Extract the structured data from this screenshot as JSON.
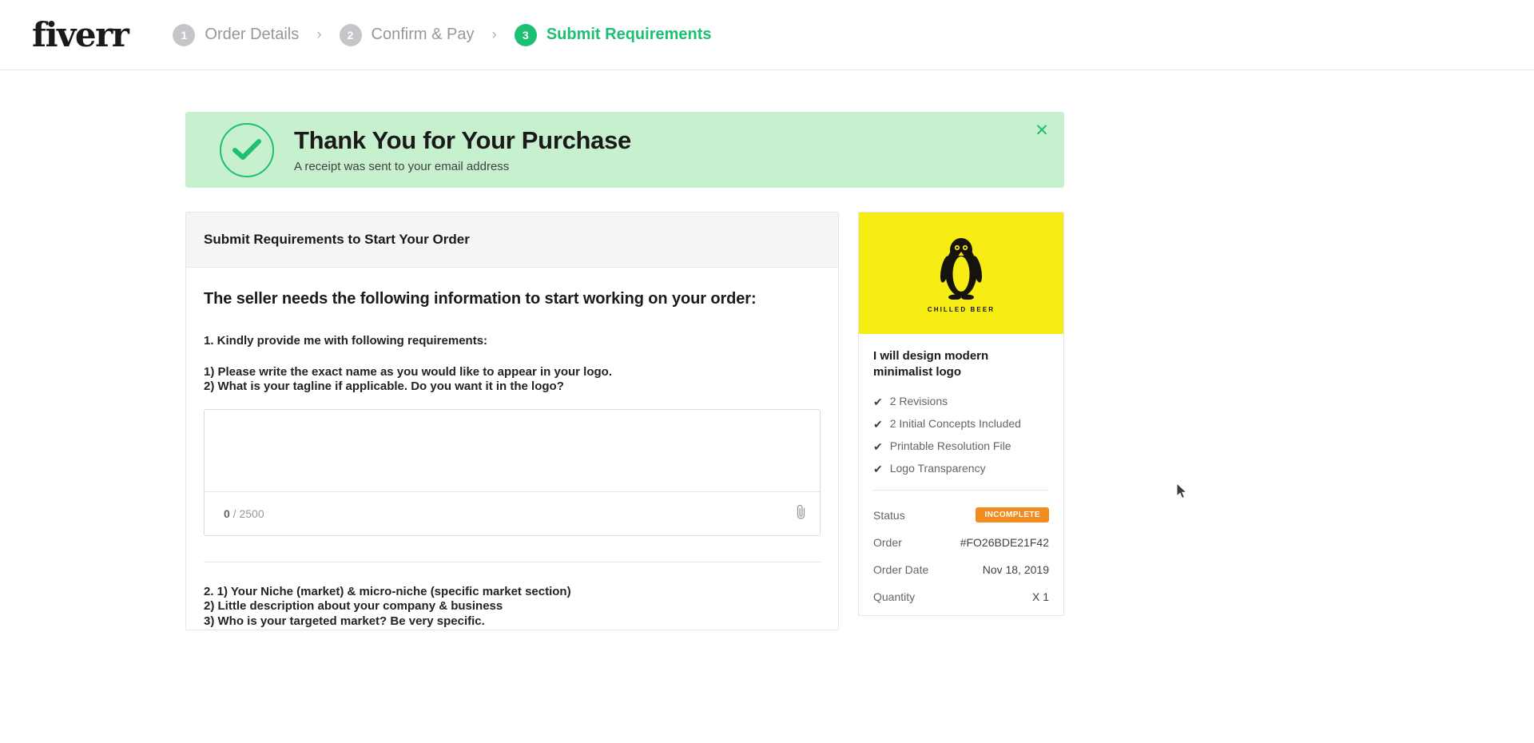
{
  "header": {
    "logo": "fiverr",
    "steps": [
      {
        "num": "1",
        "label": "Order Details",
        "active": false
      },
      {
        "num": "2",
        "label": "Confirm & Pay",
        "active": false
      },
      {
        "num": "3",
        "label": "Submit Requirements",
        "active": true
      }
    ],
    "separator": "›"
  },
  "banner": {
    "icon": "check-circle-icon",
    "title": "Thank You for Your Purchase",
    "subtitle": "A receipt was sent to your email address",
    "close_label": "✕",
    "bg_color": "#c7f0ce",
    "accent_color": "#1dbf73"
  },
  "requirements": {
    "card_title": "Submit Requirements to Start Your Order",
    "intro": "The seller needs the following information to start working on your order:",
    "items": [
      {
        "question": "1. Kindly provide me with following requirements:",
        "sub_lines": [
          "1) Please write the exact name as you would like to appear in your logo.",
          "2) What is your tagline if applicable. Do you want it in the logo?"
        ],
        "textarea_value": "",
        "textarea_placeholder": "",
        "counter_current": "0",
        "counter_divider": " / ",
        "counter_max": "2500",
        "attachment_icon": "paperclip-icon"
      },
      {
        "question": "2. 1) Your Niche (market) & micro-niche (specific market section)",
        "sub_lines": [
          "2) Little description about your company & business",
          "3) Who is your targeted market? Be very specific."
        ]
      }
    ]
  },
  "gig": {
    "thumbnail": {
      "bg_color": "#f7ec13",
      "icon": "penguin-icon",
      "caption": "CHILLED BEER"
    },
    "title": "I will design modern minimalist logo",
    "features": [
      "2 Revisions",
      "2 Initial Concepts Included",
      "Printable Resolution File",
      "Logo Transparency"
    ],
    "tick_icon": "check-icon",
    "details": [
      {
        "label": "Status",
        "value": "INCOMPLETE",
        "is_badge": true,
        "badge_color": "#f28b20"
      },
      {
        "label": "Order",
        "value": "#FO26BDE21F42",
        "is_badge": false
      },
      {
        "label": "Order Date",
        "value": "Nov 18, 2019",
        "is_badge": false
      },
      {
        "label": "Quantity",
        "value": "X 1",
        "is_badge": false
      }
    ]
  },
  "cursor": {
    "icon": "mouse-pointer-icon"
  }
}
